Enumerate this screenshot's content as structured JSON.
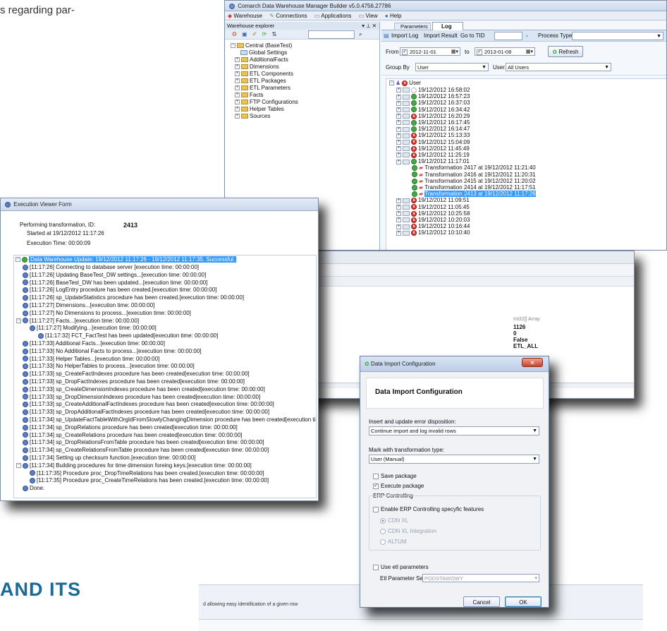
{
  "doc": {
    "text_top": "s regarding par-",
    "heading": "AND ITS",
    "bottom_caption": "d allowing easy identification of a given row"
  },
  "main": {
    "title": "Comarch Data Warehouse Manager Builder v5.0.4756.27786",
    "menu": [
      "Warehouse",
      "Connections",
      "Applications",
      "View",
      "Help"
    ],
    "explorer_title": "Warehouse explorer",
    "explorer_pin": "▾ ⊥ ✕",
    "tree": [
      "Central (BaseTest)",
      "Global Settings",
      "AdditionalFacts",
      "Dimensions",
      "ETL Components",
      "ETL Packages",
      "ETL Parameters",
      "Facts",
      "FTP Configurations",
      "Helper Tables",
      "Sources"
    ],
    "tabs": [
      "Parameters",
      "Log"
    ],
    "toolbar": [
      "Import Log",
      "Import Result",
      "Go to TID",
      "Process Type"
    ],
    "from_label": "From",
    "from_value": "2012-11-01",
    "to_label": "to",
    "to_value": "2013-01-08",
    "refresh": "Refresh",
    "groupby_label": "Group By",
    "groupby_value": "User",
    "user_label": "User",
    "user_value": "All Users",
    "log_root": "User",
    "log_top": [
      {
        "t": "19/12/2012 16:58:02",
        "s": "none"
      },
      {
        "t": "19/12/2012 16:57:23",
        "s": "ok"
      },
      {
        "t": "19/12/2012 16:37:03",
        "s": "ok"
      },
      {
        "t": "19/12/2012 16:34:42",
        "s": "ok"
      },
      {
        "t": "19/12/2012 16:20:29",
        "s": "err"
      },
      {
        "t": "19/12/2012 16:17:45",
        "s": "ok"
      },
      {
        "t": "19/12/2012 16:14:47",
        "s": "ok"
      },
      {
        "t": "19/12/2012 15:13:33",
        "s": "err"
      },
      {
        "t": "19/12/2012 15:04:09",
        "s": "err"
      },
      {
        "t": "19/12/2012 11:45:49",
        "s": "err"
      },
      {
        "t": "19/12/2012 11:25:19",
        "s": "err"
      },
      {
        "t": "19/12/2012 11:17:01",
        "s": "ok"
      }
    ],
    "transforms": [
      "Transformation 2417 at 19/12/2012 11:21:40",
      "Transformation 2416 at 19/12/2012 11:20:31",
      "Transformation 2415 at 19/12/2012 11:20:02",
      "Transformation 2414 at 19/12/2012 11:17:51",
      "Transformation 2413 at 19/12/2012 11:17:26"
    ],
    "log_bottom": [
      {
        "t": "19/12/2012 11:09:51",
        "s": "err"
      },
      {
        "t": "19/12/2012 11:05:45",
        "s": "err"
      },
      {
        "t": "19/12/2012 10:25:58",
        "s": "err"
      },
      {
        "t": "19/12/2012 10:20:03",
        "s": "err"
      },
      {
        "t": "19/12/2012 10:16:44",
        "s": "err"
      },
      {
        "t": "19/12/2012 10:10:40",
        "s": "err"
      }
    ]
  },
  "exec": {
    "title": "Execution Viewer Form",
    "perf_label": "Performing transformation, ID:",
    "perf_id": "2413",
    "started": "Started at 19/12/2012 11:17:26",
    "exectime": "Execution Time: 00:00:09",
    "root": "Data Warehouse Update: 19/12/2012 11:17:26 - 19/12/2012 11:17:35. Successful.",
    "lines": [
      {
        "l": 1,
        "t": "[11:17:26] Connecting to database server [execution time: 00:00:00]"
      },
      {
        "l": 1,
        "t": "[11:17:26] Updating BaseTest_DW settings...[execution time: 00:00:00]"
      },
      {
        "l": 1,
        "t": "[11:17:26] BaseTest_DW has been updated...[execution time: 00:00:00]"
      },
      {
        "l": 1,
        "t": "[11:17:26] LogEntry procedure has been created.[execution time: 00:00:00]"
      },
      {
        "l": 1,
        "t": "[11:17:26] sp_UpdateStatistics procedure has been created.[execution time: 00:00:00]"
      },
      {
        "l": 1,
        "t": "[11:17:27] Dimensions...[execution time: 00:00:00]"
      },
      {
        "l": 1,
        "t": "[11:17:27] No Dimensions to process...[execution time: 00:00:00]"
      },
      {
        "l": 1,
        "t": "[11:17:27] Facts...[execution time: 00:00:00]"
      },
      {
        "l": 2,
        "t": "[11:17:27] Modifying...[execution time: 00:00:00]"
      },
      {
        "l": 3,
        "t": "[11:17:32] FCT_FactTest has been updated[execution time: 00:00:00]"
      },
      {
        "l": 1,
        "t": "[11:17:33] Additional Facts...[execution time: 00:00:00]"
      },
      {
        "l": 1,
        "t": "[11:17:33] No Additional Facts to process...[execution time: 00:00:00]"
      },
      {
        "l": 1,
        "t": "[11:17:33] Helper Tables...[execution time: 00:00:00]"
      },
      {
        "l": 1,
        "t": "[11:17:33] No HelperTables to process...[execution time: 00:00:00]"
      },
      {
        "l": 1,
        "t": "[11:17:33] sp_CreateFactIndexes procedure has been created[execution time: 00:00:00]"
      },
      {
        "l": 1,
        "t": "[11:17:33] sp_DropFactIndexes procedure has been created[execution time: 00:00:00]"
      },
      {
        "l": 1,
        "t": "[11:17:33] sp_CreateDimensionIndexes procedure has been created[execution time: 00:00:00]"
      },
      {
        "l": 1,
        "t": "[11:17:33] sp_DropDimensionIndexes procedure has been created[execution time: 00:00:00]"
      },
      {
        "l": 1,
        "t": "[11:17:33] sp_CreateAdditionalFactIndexes procedure has been created[execution time: 00:00:00]"
      },
      {
        "l": 1,
        "t": "[11:17:33] sp_DropAdditionalFactIndexes procedure has been created[execution time: 00:00:00]"
      },
      {
        "l": 1,
        "t": "[11:17:34] sp_UpdateFactTableWithOrgIdFromSlowlyChangingDimension procedure has been created[execution time: 00:00:00]"
      },
      {
        "l": 1,
        "t": "[11:17:34] sp_DropRelations procedure has been created[execution time: 00:00:00]"
      },
      {
        "l": 1,
        "t": "[11:17:34] sp_CreateRelations procedure has been created[execution time: 00:00:00]"
      },
      {
        "l": 1,
        "t": "[11:17:34] sp_DropRelationsFromTable procedure has been created[execution time: 00:00:00]"
      },
      {
        "l": 1,
        "t": "[11:17:34] sp_CreateRelationsFromTable procedure has been created[execution time: 00:00:00]"
      },
      {
        "l": 1,
        "t": "[11:17:34] Setting up checksum function.[execution time: 00:00:00]"
      },
      {
        "l": 1,
        "t": "[11:17:34] Building procedures for time dimension foreing keys.[execution time: 00:00:00]"
      },
      {
        "l": 2,
        "t": "[11:17:35] Procedure proc_DropTimeRelations has been created.[execution time: 00:00:00]"
      },
      {
        "l": 2,
        "t": "[11:17:35] Procedure proc_CreateTimeRelations has been created.[execution time: 00:00:00]"
      },
      {
        "l": 1,
        "t": "Done."
      }
    ]
  },
  "grid": {
    "type": "Int32[] Array",
    "v1": "1126",
    "v2": "0",
    "v3": "False",
    "v4": "ETL_ALL"
  },
  "dialog": {
    "title": "Data Import Configuration",
    "heading": "Data Import Configuration",
    "insert_label": "Insert and update error disposition:",
    "insert_value": "Continue import and log invalid rows",
    "mark_label": "Mark with transformation type:",
    "mark_value": "User (Manual)",
    "save_pkg": "Save package",
    "exec_pkg": "Execute package",
    "erp_group": "ERP Controlling",
    "erp_enable": "Enable ERP Controlling specyfic features",
    "radios": [
      "CDN XL",
      "CDN XL Integration",
      "ALTUM"
    ],
    "use_etl": "Use etl parameters",
    "etl_set_label": "Etl Parameter Set",
    "etl_set_value": "PODSTAWOWY",
    "cancel": "Cancel",
    "ok": "OK"
  }
}
